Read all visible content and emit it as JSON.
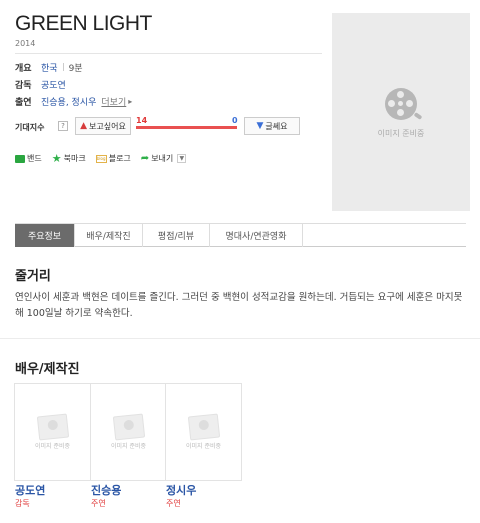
{
  "movie": {
    "title": "GREEN LIGHT",
    "year": "2014"
  },
  "info": {
    "overview_label": "개요",
    "country": "한국",
    "runtime": "9분",
    "director_label": "감독",
    "director": "공도연",
    "cast_label": "출연",
    "cast_names": "진승용, 정시우",
    "more_label": "더보기"
  },
  "rating": {
    "label": "기대지수",
    "help": "?",
    "want_label": "보고싶어요",
    "want_count": "14",
    "no_label": "글쎄요",
    "no_count": "0",
    "want_ratio": 1.0
  },
  "share": {
    "band": "밴드",
    "bookmark": "북마크",
    "blog_icon_text": "blog",
    "blog": "블로그",
    "send": "보내기"
  },
  "poster": {
    "placeholder": "이미지 준비중"
  },
  "tabs": [
    "주요정보",
    "배우/제작진",
    "평점/리뷰",
    "명대사/연관영화"
  ],
  "synopsis": {
    "title": "줄거리",
    "text": "연인사이 세훈과 백현은 데이트를 즐긴다. 그러던 중 백현이 성적교감을 원하는데. 거듭되는 요구에 세훈은 마지못해 100일날 하기로 약속한다."
  },
  "people": {
    "title": "배우/제작진",
    "placeholder": "이미지 준비중",
    "list": [
      {
        "name": "공도연",
        "role": "감독"
      },
      {
        "name": "진승용",
        "role": "주연"
      },
      {
        "name": "정시우",
        "role": "주연"
      }
    ]
  },
  "colors": {
    "link": "#2a55a5",
    "accent_red": "#e03a3a",
    "active_tab": "#6b6b6b"
  }
}
